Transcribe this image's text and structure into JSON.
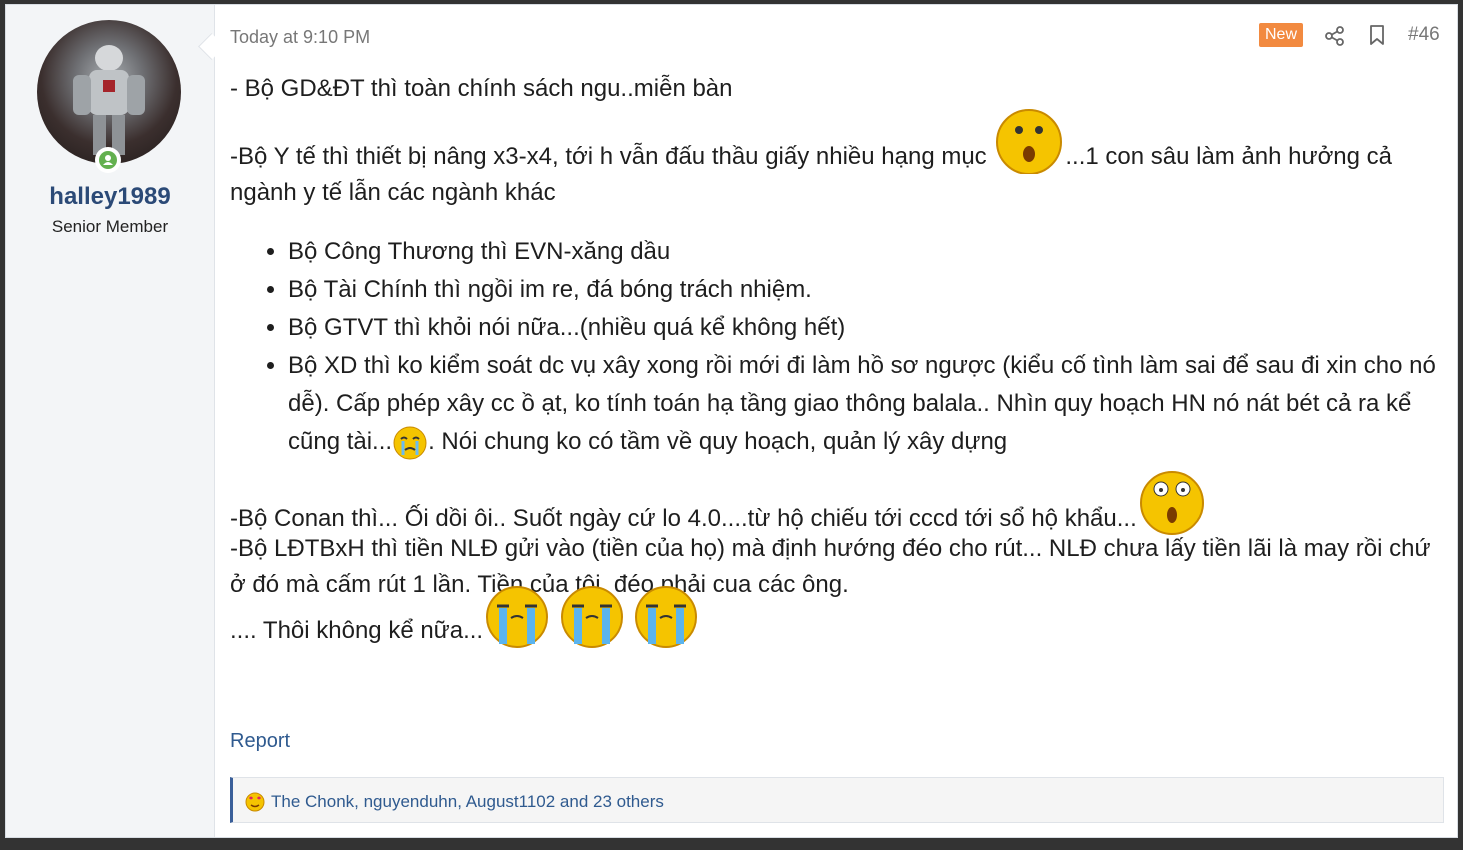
{
  "user": {
    "name": "halley1989",
    "title": "Senior Member"
  },
  "post": {
    "time": "Today at 9:10 PM",
    "badge": "New",
    "number": "#46",
    "line1": "- Bộ GD&ĐT thì toàn chính sách ngu..miễn bàn",
    "line2a": "-Bộ Y tế thì thiết bị nâng x3-x4, tới h vẫn đấu thầu giấy nhiều hạng mục ",
    "line2b": "...1 con sâu làm ảnh hưởng cả ngành y tế lẫn các ngành khác",
    "bullets": [
      "Bộ Công Thương thì EVN-xăng dầu",
      "Bộ Tài Chính thì ngồi im re, đá bóng trách nhiệm.",
      "Bộ GTVT thì khỏi nói nữa...(nhiều quá kể không hết)"
    ],
    "bullet4a": "Bộ XD thì ko kiểm soát dc vụ xây xong rồi mới đi làm hồ sơ ngược (kiểu cố tình làm sai để sau đi xin cho nó dễ). Cấp phép xây cc ồ ạt, ko tính toán hạ tầng giao thông balala.. Nhìn quy hoạch HN nó nát bét cả ra kể cũng tài...",
    "bullet4b": ". Nói chung ko có tầm về quy hoạch, quản lý xây dựng",
    "line3": "-Bộ Conan thì... Ối dồi ôi.. Suốt ngày cứ lo 4.0....từ hộ chiếu tới cccd tới sổ hộ khẩu...",
    "line4": "-Bộ LĐTBxH thì tiền NLĐ gửi vào (tiền của họ) mà định hướng đéo cho rút... NLĐ chưa lấy tiền lãi là may rồi chứ ở đó mà cấm rút 1 lần. Tiền của tôi, đéo phải cua các ông.",
    "line5": ".... Thôi không kể nữa...",
    "report": "Report",
    "reactions": "The Chonk, nguyenduhn, August1102 and 23 others"
  },
  "colors": {
    "accent": "#2f5a8f",
    "badge": "#f28a40",
    "username": "#2b4a77",
    "online": "#63b04f"
  }
}
